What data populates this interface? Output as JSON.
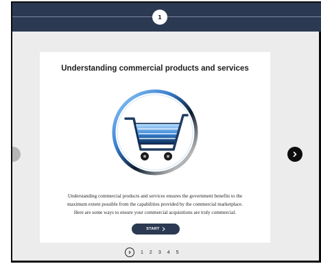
{
  "progress": {
    "step_label": "1"
  },
  "card": {
    "title": "Understanding commercial products and services",
    "illustration_icon": "shopping-cart-icon",
    "body_lines": [
      "Understanding commercial products and services ensures the government benefits to the",
      "maximum extent possible from the capabilities provided by the commercial marketplace.",
      "Here are some ways to ensure your commercial acquisitions are truly commercial."
    ],
    "start_label": "START",
    "start_icon": "chevron-right-icon"
  },
  "navigation": {
    "prev_icon": "chevron-left-icon",
    "next_icon": "chevron-right-icon"
  },
  "pagination": {
    "current_icon": "chevron-right-icon",
    "pages": [
      "1",
      "2",
      "3",
      "4",
      "5"
    ]
  },
  "colors": {
    "header_bg": "#2b3a52",
    "button_bg": "#2b3a52",
    "stage_bg": "#ececec"
  }
}
